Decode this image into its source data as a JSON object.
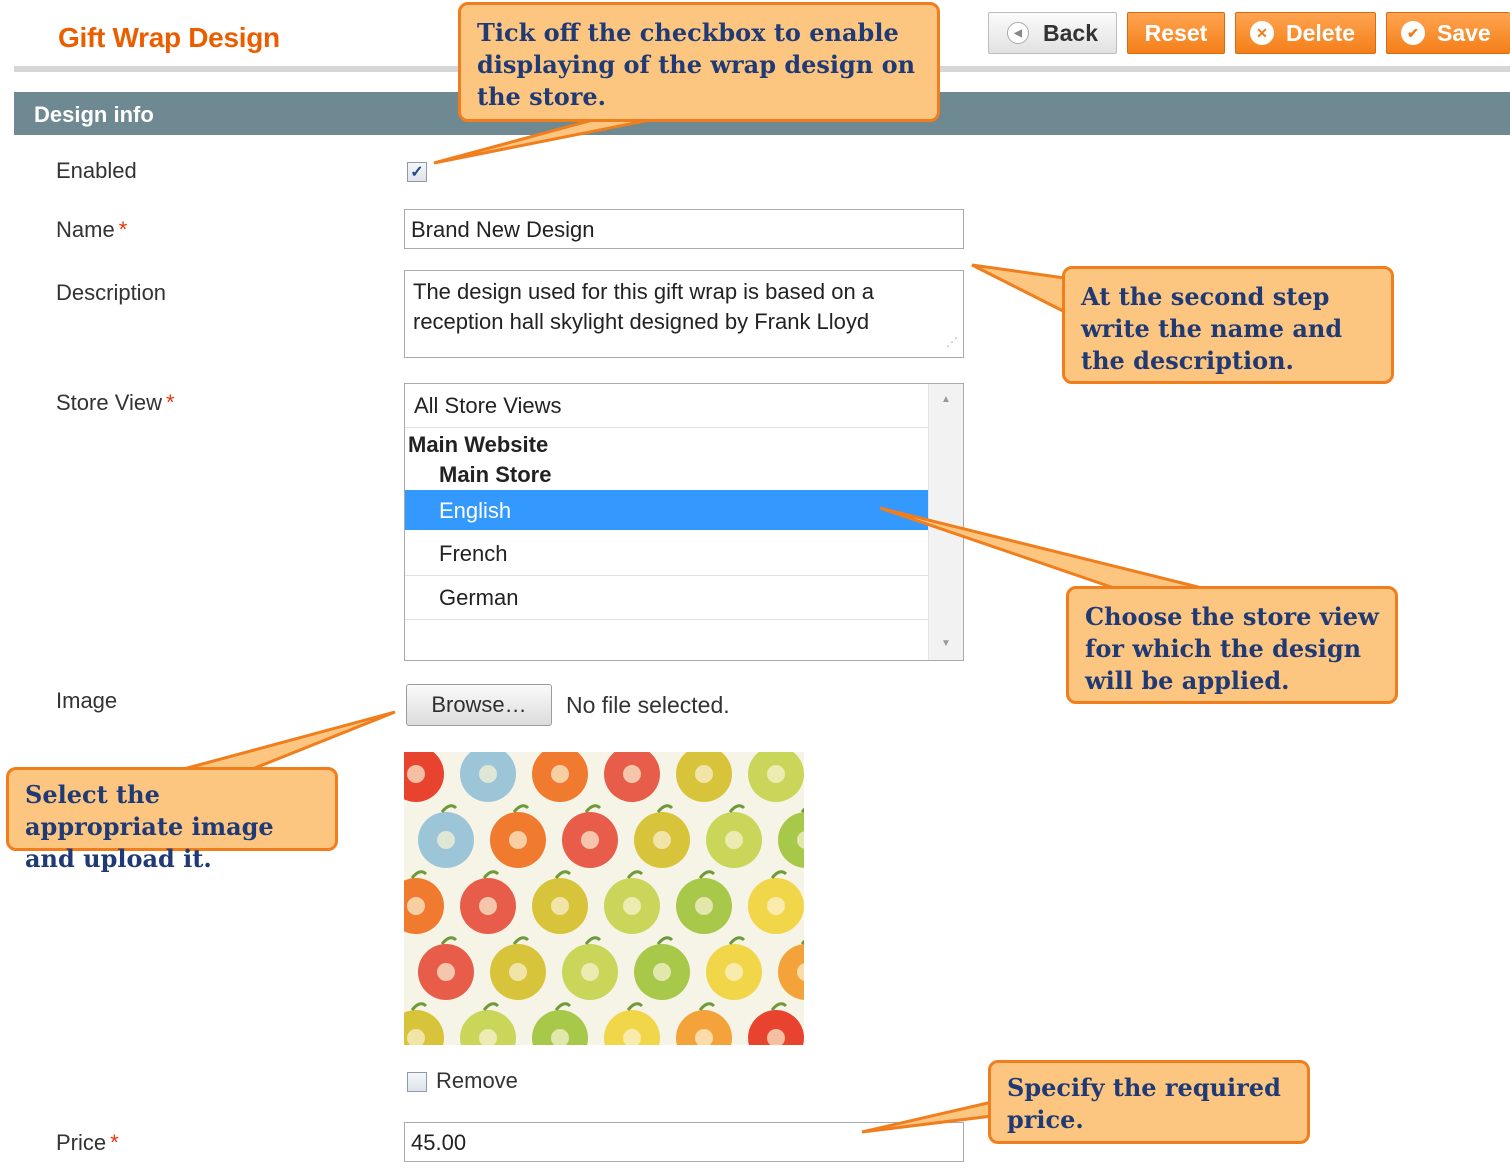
{
  "header": {
    "title": "Gift Wrap Design",
    "buttons": {
      "back": "Back",
      "reset": "Reset",
      "delete": "Delete",
      "save": "Save"
    }
  },
  "section": {
    "title": "Design info"
  },
  "form": {
    "enabled": {
      "label": "Enabled",
      "checked": true
    },
    "name": {
      "label": "Name",
      "required_mark": "*",
      "value": "Brand New Design"
    },
    "description": {
      "label": "Description",
      "lines": [
        "The design used for this gift wrap is based on a",
        "reception hall skylight designed by Frank Lloyd"
      ]
    },
    "store_view": {
      "label": "Store View",
      "required_mark": "*",
      "options": [
        {
          "text": "All Store Views",
          "kind": "option"
        },
        {
          "text": "Main Website",
          "kind": "group"
        },
        {
          "text": "Main Store",
          "kind": "subgroup"
        },
        {
          "text": "English",
          "kind": "option",
          "selected": true
        },
        {
          "text": "French",
          "kind": "option"
        },
        {
          "text": "German",
          "kind": "option"
        }
      ],
      "selected_color": "#3399ff"
    },
    "image": {
      "label": "Image",
      "browse_label": "Browse…",
      "file_status": "No file selected.",
      "remove_label": "Remove"
    },
    "price": {
      "label": "Price",
      "required_mark": "*",
      "value": "45.00"
    }
  },
  "callouts": [
    "Tick off the checkbox to enable displaying of the wrap design on the store.",
    "At the second step write the name and the description.",
    "Choose the store view for which the design will be applied.",
    "Select the appropriate image and upload it.",
    "Specify the required price."
  ],
  "colors": {
    "accent": "#eb5e00",
    "callout_fill": "#fcc580",
    "callout_border": "#f07e1c",
    "callout_text": "#1f3a75",
    "section_bar": "#6f8992"
  }
}
